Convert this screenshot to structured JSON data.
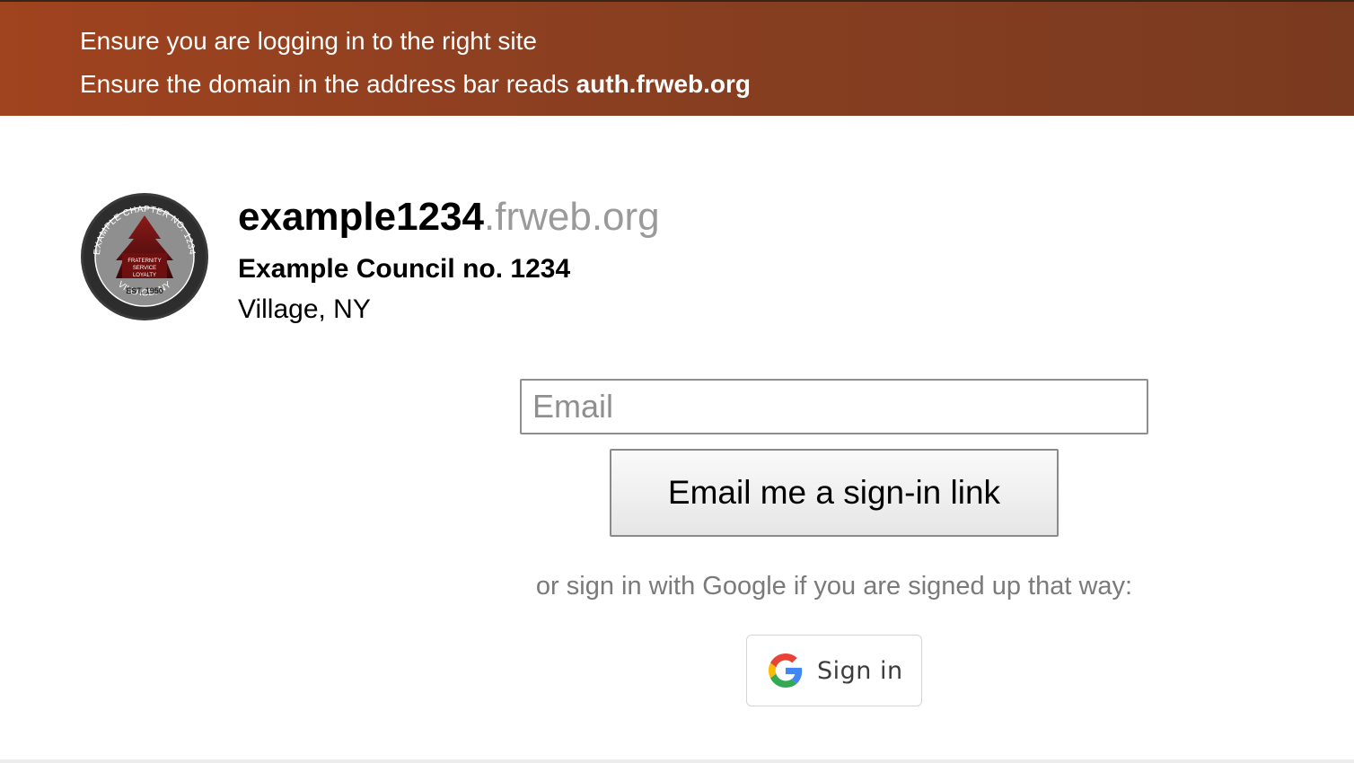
{
  "banner": {
    "line1": "Ensure you are logging in to the right site",
    "line2_prefix": "Ensure the domain in the address bar reads ",
    "line2_domain": "auth.frweb.org",
    "color": "#8f4120"
  },
  "org": {
    "subdomain": "example1234",
    "base_domain": ".frweb.org",
    "name": "Example Council no. 1234",
    "location": "Village, NY",
    "logo": {
      "top_text": "EXAMPLE CHAPTER NO. 1234",
      "bottom_text": "VILLAGE, NY",
      "motto_1": "FRATERNITY",
      "motto_2": "SERVICE",
      "motto_3": "LOYALTY",
      "established": "EST. 1950"
    }
  },
  "form": {
    "email_placeholder": "Email",
    "email_value": "",
    "submit_label": "Email me a sign-in link",
    "alt_text": "or sign in with Google if you are signed up that way:",
    "google_label": "Sign in",
    "google_icon": "google-g-icon"
  }
}
